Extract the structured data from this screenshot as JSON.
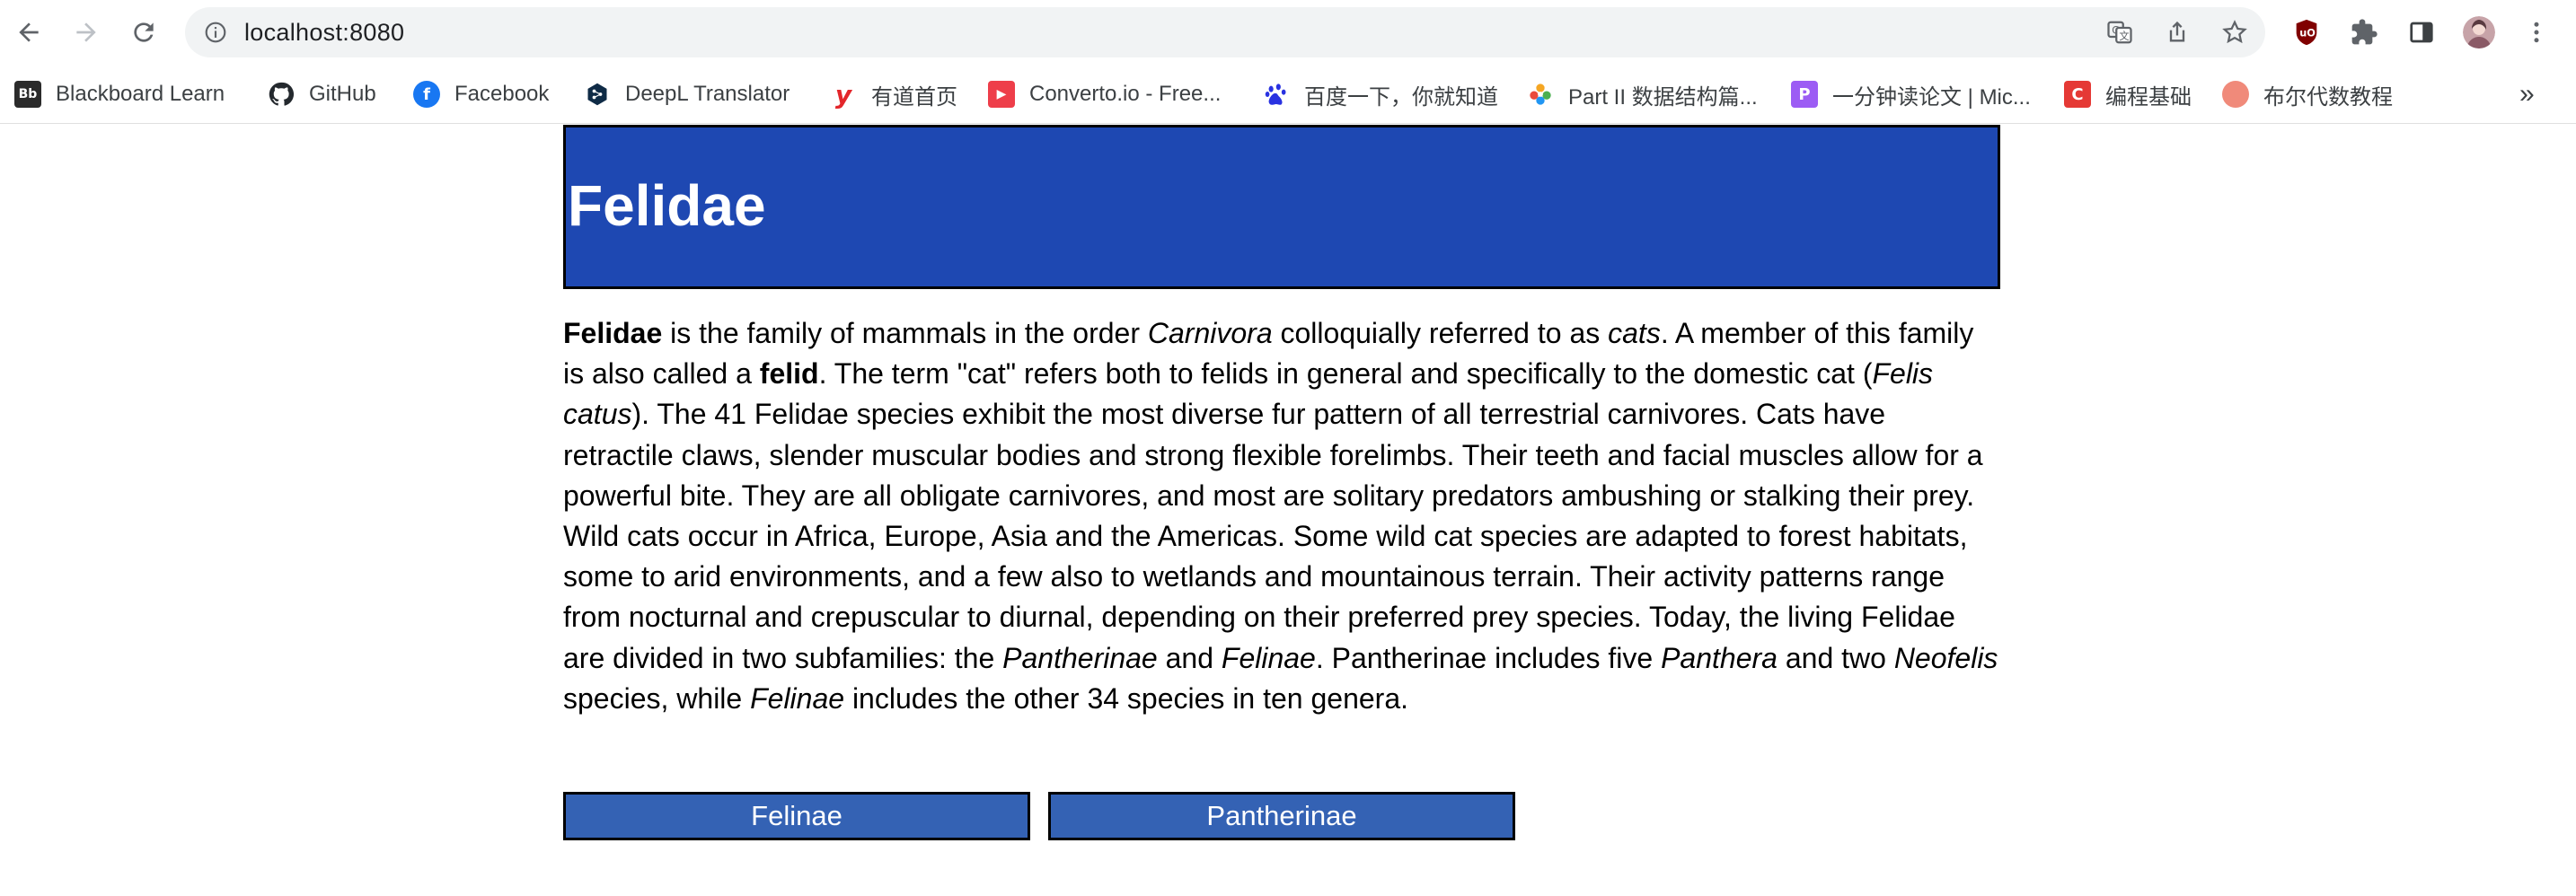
{
  "browser": {
    "url": "localhost:8080",
    "colors": {
      "omnibox_bg": "#f1f3f4",
      "toolbar_bg": "#ffffff"
    },
    "bookmarks": [
      {
        "label": "Blackboard Learn",
        "icon": "blackboard-icon",
        "icon_text": "Bb",
        "color": "#2b2b2b"
      },
      {
        "label": "GitHub",
        "icon": "github-icon",
        "icon_text": "",
        "color": "#24292e"
      },
      {
        "label": "Facebook",
        "icon": "facebook-icon",
        "icon_text": "f",
        "color": "#1877f2"
      },
      {
        "label": "DeepL Translator",
        "icon": "deepl-icon",
        "icon_text": "",
        "color": "#0f2b46"
      },
      {
        "label": "有道首页",
        "icon": "youdao-icon",
        "icon_text": "y",
        "color": "#e3262b"
      },
      {
        "label": "Converto.io - Free...",
        "icon": "converto-icon",
        "icon_text": "▶",
        "color": "#ee3e4a"
      },
      {
        "label": "百度一下，你就知道",
        "icon": "baidu-icon",
        "icon_text": "",
        "color": "#2932e1"
      },
      {
        "label": "Part II 数据结构篇...",
        "icon": "leetcode-flower-icon",
        "icon_text": "",
        "color": "#f5a623"
      },
      {
        "label": "一分钟读论文 | Mic...",
        "icon": "p-app-icon",
        "icon_text": "P",
        "color": "#9c5cf4"
      },
      {
        "label": "编程基础",
        "icon": "c-app-icon",
        "icon_text": "C",
        "color": "#e53935"
      },
      {
        "label": "布尔代数教程",
        "icon": "circle-site-icon",
        "icon_text": "",
        "color": "#f08a7a"
      }
    ],
    "more_label": "»"
  },
  "page": {
    "title": "Felidae",
    "colors": {
      "header_bg": "#1e48b2",
      "button_bg": "#3462b4"
    },
    "paragraph": [
      {
        "t": "b",
        "v": "Felidae"
      },
      {
        "t": "n",
        "v": " is the family of mammals in the order "
      },
      {
        "t": "i",
        "v": "Carnivora"
      },
      {
        "t": "n",
        "v": " colloquially referred to as "
      },
      {
        "t": "i",
        "v": "cats"
      },
      {
        "t": "n",
        "v": ". A member of this family is also called a "
      },
      {
        "t": "b",
        "v": "felid"
      },
      {
        "t": "n",
        "v": ". The term \"cat\" refers both to felids in general and specifically to the domestic cat ("
      },
      {
        "t": "i",
        "v": "Felis catus"
      },
      {
        "t": "n",
        "v": "). The 41 Felidae species exhibit the most diverse fur pattern of all terrestrial carnivores. Cats have retractile claws, slender muscular bodies and strong flexible forelimbs. Their teeth and facial muscles allow for a powerful bite. They are all obligate carnivores, and most are solitary predators ambushing or stalking their prey. Wild cats occur in Africa, Europe, Asia and the Americas. Some wild cat species are adapted to forest habitats, some to arid environments, and a few also to wetlands and mountainous terrain. Their activity patterns range from nocturnal and crepuscular to diurnal, depending on their preferred prey species. Today, the living Felidae are divided in two subfamilies: the "
      },
      {
        "t": "i",
        "v": "Pantherinae"
      },
      {
        "t": "n",
        "v": " and "
      },
      {
        "t": "i",
        "v": "Felinae"
      },
      {
        "t": "n",
        "v": ". Pantherinae includes five "
      },
      {
        "t": "i",
        "v": "Panthera"
      },
      {
        "t": "n",
        "v": " and two "
      },
      {
        "t": "i",
        "v": "Neofelis"
      },
      {
        "t": "n",
        "v": " species, while "
      },
      {
        "t": "i",
        "v": "Felinae"
      },
      {
        "t": "n",
        "v": " includes the other 34 species in ten genera."
      }
    ],
    "buttons": {
      "felinae": "Felinae",
      "pantherinae": "Pantherinae"
    }
  }
}
